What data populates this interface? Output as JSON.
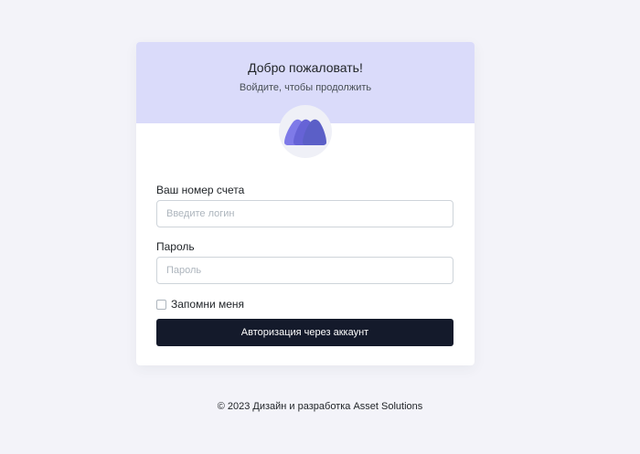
{
  "header": {
    "title": "Добро пожаловать!",
    "subtitle": "Войдите, чтобы продолжить"
  },
  "logo": {
    "icon": "mountains-logo-icon",
    "colors": [
      "#7e7ae8",
      "#6663d6",
      "#5b5fc7"
    ]
  },
  "form": {
    "account_label": "Ваш номер счета",
    "account_placeholder": "Введите логин",
    "account_value": "",
    "password_label": "Пароль",
    "password_placeholder": "Пароль",
    "password_value": "",
    "remember_label": "Запомни меня",
    "remember_checked": false,
    "submit_label": "Авторизация через аккаунт"
  },
  "footer": {
    "text": "© 2023 Дизайн и разработка Asset Solutions"
  },
  "colors": {
    "page_background": "#f3f3f9",
    "header_background": "#dadbfa",
    "button_background": "#141a2b"
  }
}
